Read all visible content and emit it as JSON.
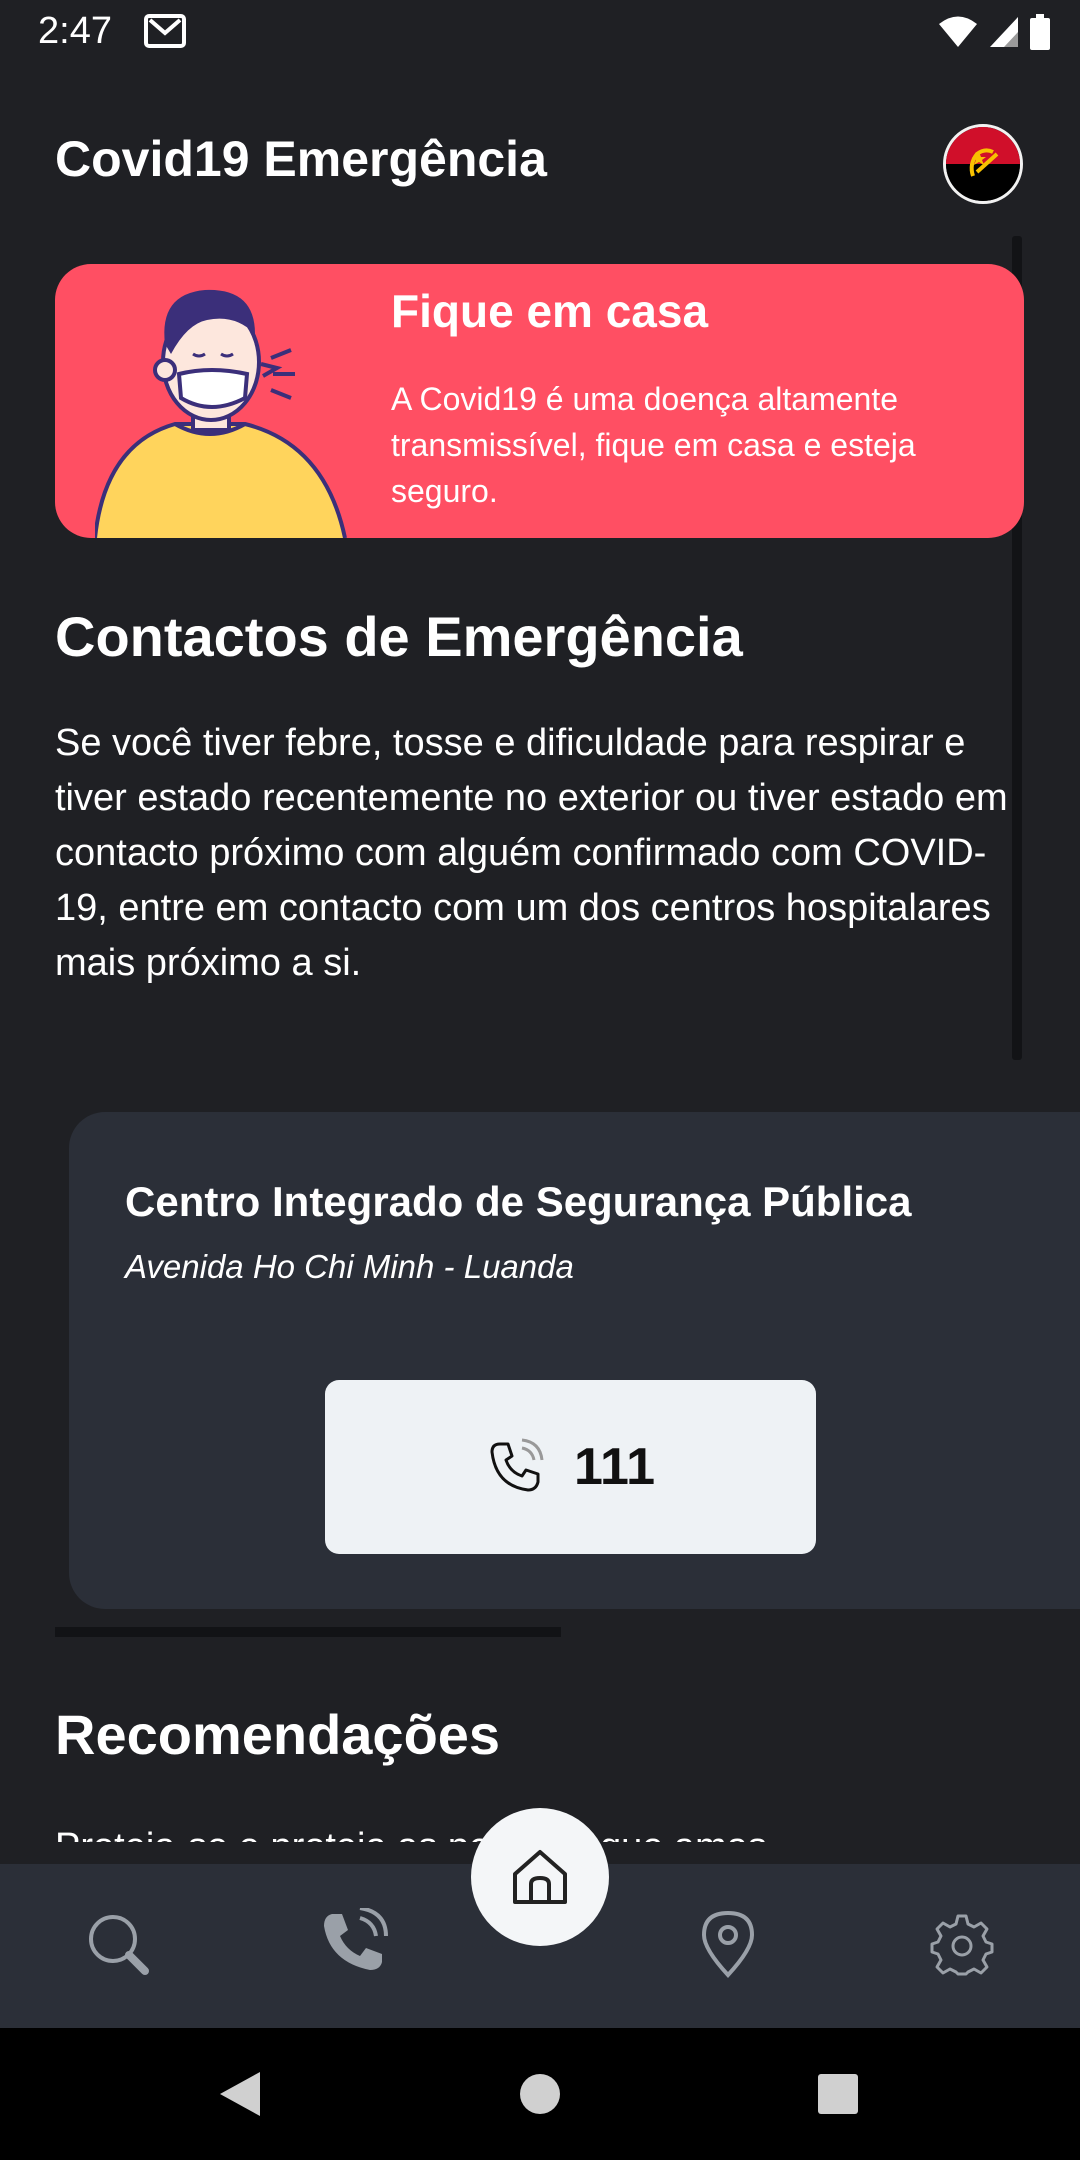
{
  "status_bar": {
    "time": "2:47"
  },
  "header": {
    "title": "Covid19 Emergência"
  },
  "banner": {
    "title": "Fique em casa",
    "text": "A Covid19 é uma doença altamente transmissível, fique em casa e esteja seguro."
  },
  "contacts_section": {
    "title": "Contactos de Emergência",
    "text": "Se você tiver febre, tosse e dificuldade para respirar e tiver estado recentemente no exterior ou tiver estado em contacto próximo com alguém confirmado com COVID-19, entre em contacto com um dos centros hospitalares mais próximo a si."
  },
  "contact_card": {
    "name": "Centro Integrado de Segurança Pública",
    "address": "Avenida Ho Chi Minh - Luanda",
    "phone": "111"
  },
  "recommendations_section": {
    "title": "Recomendações",
    "text": "Proteja-se e proteja as pessoas que amas"
  },
  "bottom_nav": {
    "items": [
      {
        "icon": "search-icon"
      },
      {
        "icon": "phone-call-icon"
      },
      {
        "icon": "home-icon"
      },
      {
        "icon": "map-pin-icon"
      },
      {
        "icon": "settings-icon"
      }
    ]
  },
  "colors": {
    "background": "#1f2024",
    "banner": "#ff4f63",
    "card": "#2b2f38",
    "call_button": "#eef2f5"
  }
}
